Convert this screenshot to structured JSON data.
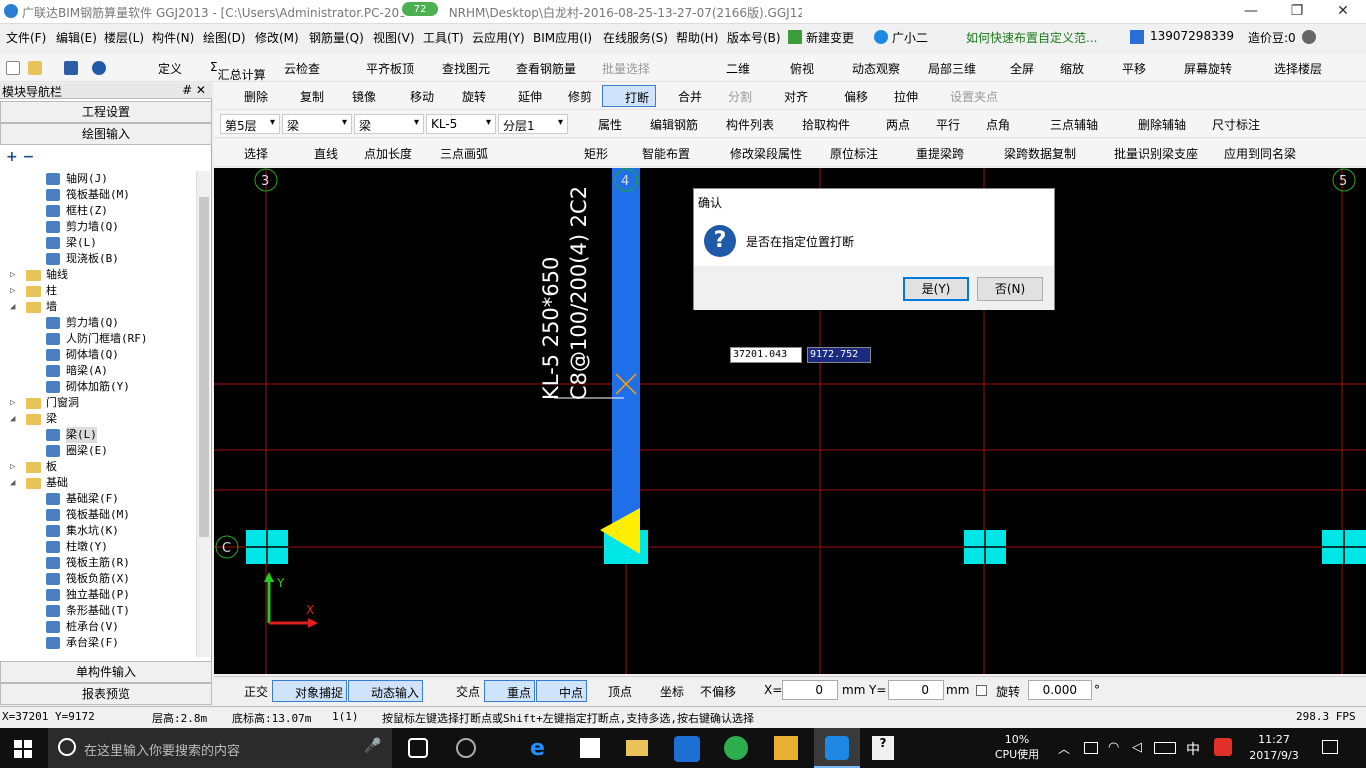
{
  "window": {
    "title": "广联达BIM钢筋算量软件 GGJ2013 - [C:\\Users\\Administrator.PC-201",
    "title_rest": "NRHM\\Desktop\\白龙村-2016-08-25-13-27-07(2166版).GGJ12]",
    "badge": "72",
    "min": "—",
    "max": "❐",
    "close": "✕"
  },
  "menu": {
    "items": [
      "文件(F)",
      "编辑(E)",
      "楼层(L)",
      "构件(N)",
      "绘图(D)",
      "修改(M)",
      "钢筋量(Q)",
      "视图(V)",
      "工具(T)",
      "云应用(Y)",
      "BIM应用(I)",
      "在线服务(S)",
      "帮助(H)",
      "版本号(B)",
      "新建变更",
      "广小二"
    ],
    "tip": "如何快速布置自定义范...",
    "phone": "13907298339",
    "cost": "造价豆:0"
  },
  "toolbar1": [
    "定义",
    "汇总计算",
    "云检查",
    "平齐板顶",
    "查找图元",
    "查看钢筋量",
    "批量选择",
    "二维",
    "俯视",
    "动态观察",
    "局部三维",
    "全屏",
    "缩放",
    "平移",
    "屏幕旋转",
    "选择楼层"
  ],
  "toolbar2": [
    "删除",
    "复制",
    "镜像",
    "移动",
    "旋转",
    "延伸",
    "修剪",
    "打断",
    "合并",
    "分割",
    "对齐",
    "偏移",
    "拉伸",
    "设置夹点"
  ],
  "toolbar3": {
    "floor": "第5层",
    "cat": "梁",
    "type": "梁",
    "comp": "KL-5",
    "layer": "分层1",
    "items": [
      "属性",
      "编辑钢筋",
      "构件列表",
      "拾取构件",
      "两点",
      "平行",
      "点角",
      "三点辅轴",
      "删除辅轴",
      "尺寸标注"
    ]
  },
  "toolbar4": [
    "选择",
    "直线",
    "点加长度",
    "三点画弧",
    "矩形",
    "智能布置",
    "修改梁段属性",
    "原位标注",
    "重提梁跨",
    "梁跨数据复制",
    "批量识别梁支座",
    "应用到同名梁"
  ],
  "nav": {
    "header": "模块导航栏",
    "pin": "# ✕",
    "btn1": "工程设置",
    "btn2": "绘图输入",
    "btn3": "单构件输入",
    "btn4": "报表预览",
    "tree": [
      {
        "label": "轴网(J)",
        "kind": "leaf",
        "indent": 2
      },
      {
        "label": "筏板基础(M)",
        "kind": "leaf",
        "indent": 2
      },
      {
        "label": "框柱(Z)",
        "kind": "leaf",
        "indent": 2
      },
      {
        "label": "剪力墙(Q)",
        "kind": "leaf",
        "indent": 2
      },
      {
        "label": "梁(L)",
        "kind": "leaf",
        "indent": 2
      },
      {
        "label": "现浇板(B)",
        "kind": "leaf",
        "indent": 2
      },
      {
        "label": "轴线",
        "kind": "folder",
        "indent": 1,
        "exp": "▷"
      },
      {
        "label": "柱",
        "kind": "folder",
        "indent": 1,
        "exp": "▷"
      },
      {
        "label": "墙",
        "kind": "folder",
        "indent": 1,
        "exp": "◢"
      },
      {
        "label": "剪力墙(Q)",
        "kind": "leaf",
        "indent": 2
      },
      {
        "label": "人防门框墙(RF)",
        "kind": "leaf",
        "indent": 2
      },
      {
        "label": "砌体墙(Q)",
        "kind": "leaf",
        "indent": 2
      },
      {
        "label": "暗梁(A)",
        "kind": "leaf",
        "indent": 2
      },
      {
        "label": "砌体加筋(Y)",
        "kind": "leaf",
        "indent": 2
      },
      {
        "label": "门窗洞",
        "kind": "folder",
        "indent": 1,
        "exp": "▷"
      },
      {
        "label": "梁",
        "kind": "folder",
        "indent": 1,
        "exp": "◢"
      },
      {
        "label": "梁(L)",
        "kind": "leaf",
        "indent": 2,
        "selected": true
      },
      {
        "label": "圈梁(E)",
        "kind": "leaf",
        "indent": 2
      },
      {
        "label": "板",
        "kind": "folder",
        "indent": 1,
        "exp": "▷"
      },
      {
        "label": "基础",
        "kind": "folder",
        "indent": 1,
        "exp": "◢"
      },
      {
        "label": "基础梁(F)",
        "kind": "leaf",
        "indent": 2
      },
      {
        "label": "筏板基础(M)",
        "kind": "leaf",
        "indent": 2
      },
      {
        "label": "集水坑(K)",
        "kind": "leaf",
        "indent": 2
      },
      {
        "label": "柱墩(Y)",
        "kind": "leaf",
        "indent": 2
      },
      {
        "label": "筏板主筋(R)",
        "kind": "leaf",
        "indent": 2
      },
      {
        "label": "筏板负筋(X)",
        "kind": "leaf",
        "indent": 2
      },
      {
        "label": "独立基础(P)",
        "kind": "leaf",
        "indent": 2
      },
      {
        "label": "条形基础(T)",
        "kind": "leaf",
        "indent": 2
      },
      {
        "label": "桩承台(V)",
        "kind": "leaf",
        "indent": 2
      },
      {
        "label": "承台梁(F)",
        "kind": "leaf",
        "indent": 2
      }
    ]
  },
  "canvas": {
    "axis3": "3",
    "axis4": "4",
    "axis5": "5",
    "axisC": "C",
    "beam_label1": "KL-5 250*650",
    "beam_label2": "C8@100/200(4) 2C2",
    "coord_x": "37201.043",
    "coord_y": "9172.752",
    "ucs_x": "X",
    "ucs_y": "Y"
  },
  "dialog": {
    "title": "确认",
    "icon": "?",
    "message": "是否在指定位置打断",
    "yes": "是(Y)",
    "no": "否(N)"
  },
  "snap": {
    "items": [
      "正交",
      "对象捕捉",
      "动态输入",
      "交点",
      "重点",
      "中点",
      "顶点",
      "坐标",
      "不偏移"
    ],
    "x_label": "X=",
    "x_val": "0",
    "mm1": "mm",
    "y_label": "Y=",
    "y_val": "0",
    "mm2": "mm",
    "rot": "旋转",
    "rot_val": "0.000",
    "deg": "°"
  },
  "status": {
    "xy": "X=37201 Y=9172",
    "floor_h": "层高:2.8m",
    "base_h": "底标高:13.07m",
    "count": "1(1)",
    "hint": "按鼠标左键选择打断点或Shift+左键指定打断点,支持多选,按右键确认选择",
    "fps": "298.3 FPS"
  },
  "taskbar": {
    "search": "在这里输入你要搜索的内容",
    "cpu": "10%",
    "cpu_label": "CPU使用",
    "ime": "中",
    "time": "11:27",
    "date": "2017/9/3"
  },
  "colors": {
    "beam": "#1e6fe8",
    "grid": "#a01010",
    "column": "#00e5e5",
    "cursor": "#ffa000",
    "axis_circle": "#22aa22"
  }
}
